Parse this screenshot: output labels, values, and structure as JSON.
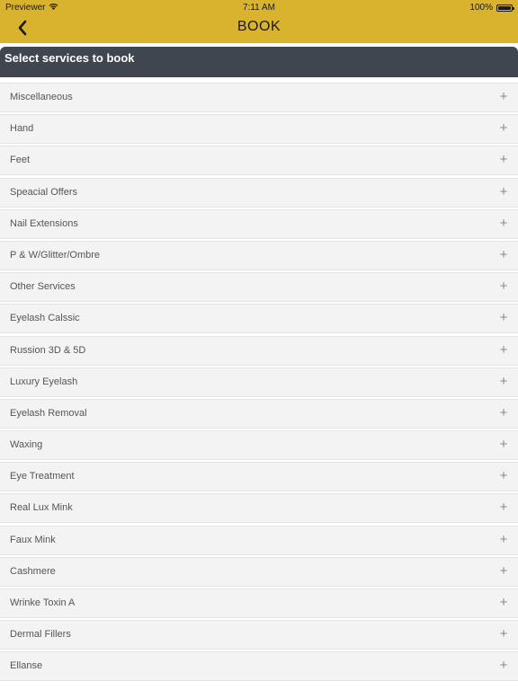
{
  "status_bar": {
    "carrier": "Previewer",
    "time": "7:11 AM",
    "battery_text": "100%",
    "battery_level": 1.0
  },
  "nav": {
    "title": "BOOK",
    "back_icon": "chevron-left-icon"
  },
  "section": {
    "title": "Select services to book"
  },
  "colors": {
    "nav_background": "#d9b22e",
    "section_header_background": "#3f4650",
    "row_background": "#f3f3f3",
    "row_text": "#555555"
  },
  "services": [
    {
      "label": "Miscellaneous",
      "icon": "plus-icon"
    },
    {
      "label": "Hand",
      "icon": "plus-icon"
    },
    {
      "label": "Feet",
      "icon": "plus-icon"
    },
    {
      "label": "Speacial Offers",
      "icon": "plus-icon"
    },
    {
      "label": "Nail Extensions",
      "icon": "plus-icon"
    },
    {
      "label": "P & W/Glitter/Ombre",
      "icon": "plus-icon"
    },
    {
      "label": "Other Services",
      "icon": "plus-icon"
    },
    {
      "label": "Eyelash Calssic",
      "icon": "plus-icon"
    },
    {
      "label": "Russion 3D & 5D",
      "icon": "plus-icon"
    },
    {
      "label": "Luxury Eyelash",
      "icon": "plus-icon"
    },
    {
      "label": "Eyelash Removal",
      "icon": "plus-icon"
    },
    {
      "label": "Waxing",
      "icon": "plus-icon"
    },
    {
      "label": "Eye Treatment",
      "icon": "plus-icon"
    },
    {
      "label": "Real Lux Mink",
      "icon": "plus-icon"
    },
    {
      "label": "Faux Mink",
      "icon": "plus-icon"
    },
    {
      "label": "Cashmere",
      "icon": "plus-icon"
    },
    {
      "label": "Wrinke Toxin A",
      "icon": "plus-icon"
    },
    {
      "label": "Dermal Fillers",
      "icon": "plus-icon"
    },
    {
      "label": "Ellanse",
      "icon": "plus-icon"
    }
  ]
}
